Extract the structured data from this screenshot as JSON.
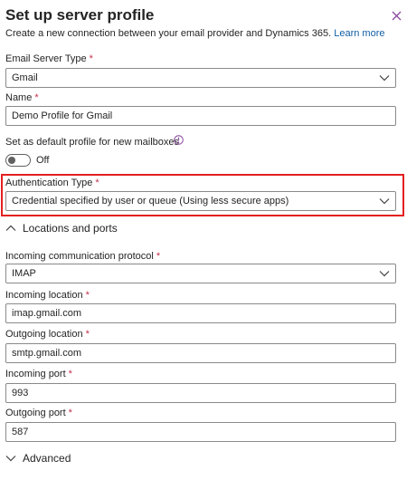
{
  "header": {
    "title": "Set up server profile",
    "subtitle": "Create a new connection between your email provider and Dynamics 365.",
    "learn_more": "Learn more"
  },
  "form": {
    "email_server_type": {
      "label": "Email Server Type",
      "value": "Gmail"
    },
    "name": {
      "label": "Name",
      "value": "Demo Profile for Gmail"
    },
    "default_profile": {
      "label": "Set as default profile for new mailboxes",
      "state": "Off"
    },
    "authentication_type": {
      "label": "Authentication Type",
      "value": "Credential specified by user or queue (Using less secure apps)"
    }
  },
  "locations": {
    "header": "Locations and ports",
    "incoming_protocol": {
      "label": "Incoming communication protocol",
      "value": "IMAP"
    },
    "incoming_location": {
      "label": "Incoming location",
      "value": "imap.gmail.com"
    },
    "outgoing_location": {
      "label": "Outgoing location",
      "value": "smtp.gmail.com"
    },
    "incoming_port": {
      "label": "Incoming port",
      "value": "993"
    },
    "outgoing_port": {
      "label": "Outgoing port",
      "value": "587"
    }
  },
  "advanced": {
    "header": "Advanced"
  },
  "required_marker": "*",
  "colors": {
    "highlight_border": "#e32020",
    "link": "#115ea3",
    "required": "#c4314b",
    "close_icon": "#8a4a9e"
  }
}
